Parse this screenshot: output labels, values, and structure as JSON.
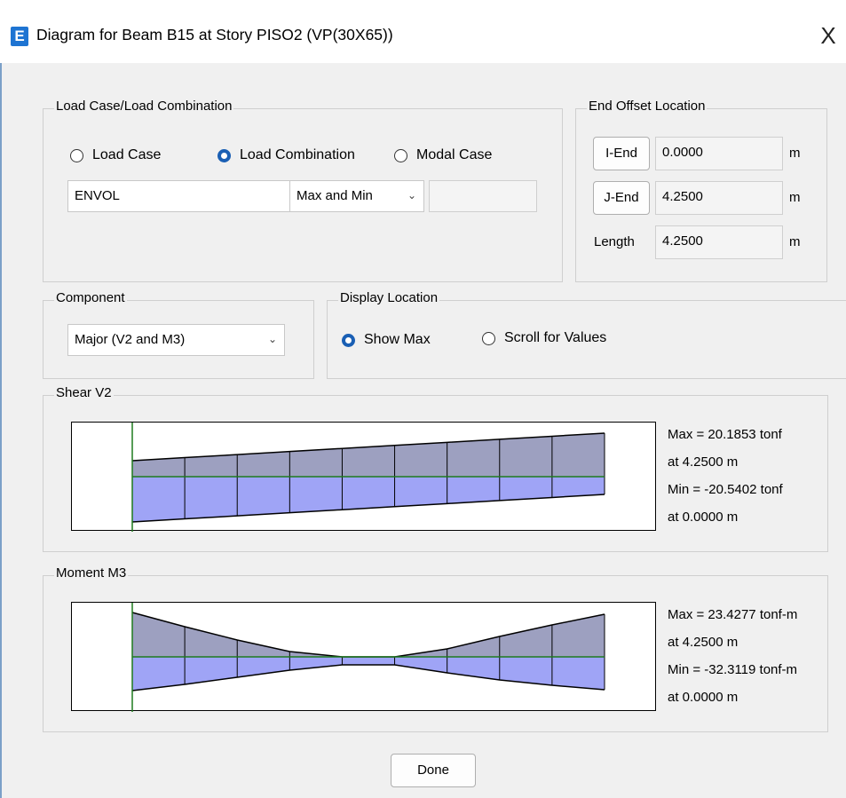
{
  "window": {
    "title": "Diagram for Beam B15 at Story PISO2 (VP(30X65))",
    "icon_letter": "E",
    "close_glyph": "X"
  },
  "load_case": {
    "group_label": "Load Case/Load Combination",
    "options": [
      "Load Case",
      "Load Combination",
      "Modal Case"
    ],
    "selected": "Load Combination",
    "combo_value": "ENVOL",
    "type_value": "Max and Min",
    "extra_value": ""
  },
  "end_offset": {
    "group_label": "End Offset Location",
    "i_end_label": "I-End",
    "i_end_value": "0.0000",
    "j_end_label": "J-End",
    "j_end_value": "4.2500",
    "length_label": "Length",
    "length_value": "4.2500",
    "unit": "m"
  },
  "component": {
    "group_label": "Component",
    "value": "Major (V2 and M3)"
  },
  "display_location": {
    "group_label": "Display Location",
    "options": [
      "Show Max",
      "Scroll for Values"
    ],
    "selected": "Show Max"
  },
  "shear": {
    "group_label": "Shear V2",
    "max_line": "Max = 20.1853 tonf",
    "max_at": "at 4.2500 m",
    "min_line": "Min = -20.5402 tonf",
    "min_at": "at 0.0000 m"
  },
  "moment": {
    "group_label": "Moment M3",
    "max_line": "Max = 23.4277 tonf-m",
    "max_at": "at 4.2500 m",
    "min_line": "Min = -32.3119 tonf-m",
    "min_at": "at 0.0000 m"
  },
  "done_label": "Done",
  "colors": {
    "fill_upper": "#9da0c0",
    "fill_lower": "#9fa4f6",
    "axis": "#1e7a1e",
    "radio_selected": "#1a5fb4",
    "app_icon": "#1e74d2"
  }
}
